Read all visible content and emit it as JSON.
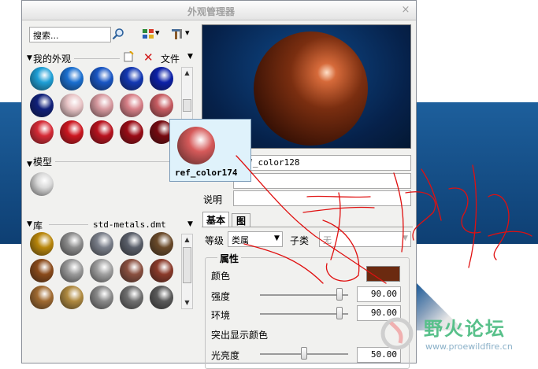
{
  "window": {
    "title": "外观管理器",
    "close_glyph": "×"
  },
  "search": {
    "value": "搜索..."
  },
  "toolbar": {
    "dropdown_glyph": "▾"
  },
  "my_appearances": {
    "label": "我的外观",
    "file_menu": "文件",
    "swatches": [
      "#1e9fd6",
      "#1a6fd0",
      "#1956c4",
      "#1338b3",
      "#0c20a8",
      "#10207a",
      "#e8c4c6",
      "#d89aa0",
      "#d88088",
      "#c85c62",
      "#d52a36",
      "#cc1620",
      "#b8121e",
      "#9a0c16",
      "#760a10"
    ]
  },
  "tooltip": {
    "name": "ref_color174",
    "color": "#d65a5a"
  },
  "model": {
    "label": "模型",
    "swatches": [
      "#d8d8d8"
    ]
  },
  "library": {
    "label": "库",
    "file": "std-metals.dmt",
    "swatches": [
      "#b8860b",
      "#8c8c8c",
      "#7a7f8a",
      "#5a5f6a",
      "#6a4a2a",
      "#8a4a1a",
      "#9a9a9a",
      "#a0a0a0",
      "#8a5040",
      "#8a3a2a",
      "#a06a30",
      "#b08a40",
      "#8a8a8a",
      "#707070",
      "#5a5a5a"
    ]
  },
  "preview": {
    "sphere_color": "#6b2a10"
  },
  "name": {
    "value": "ref_color128"
  },
  "description_label": "说明",
  "tabs": [
    {
      "label": "基本"
    },
    {
      "label": "图"
    }
  ],
  "category": {
    "label": "等级",
    "value": "类属",
    "sub_label": "子类",
    "sub_value": "无"
  },
  "properties": {
    "label": "属性",
    "color_label": "颜色",
    "color_value": "#6b2a10",
    "intensity_label": "强度",
    "intensity_value": "90.00",
    "intensity_level": 0.9,
    "ambient_label": "环境",
    "ambient_value": "90.00",
    "ambient_level": 0.9,
    "highlight_label": "突出显示颜色",
    "brightness_label": "光亮度",
    "brightness_value": "50.00",
    "brightness_level": 0.5
  },
  "watermark": {
    "title": "野火论坛",
    "url": "www.proewildfire.cn"
  }
}
